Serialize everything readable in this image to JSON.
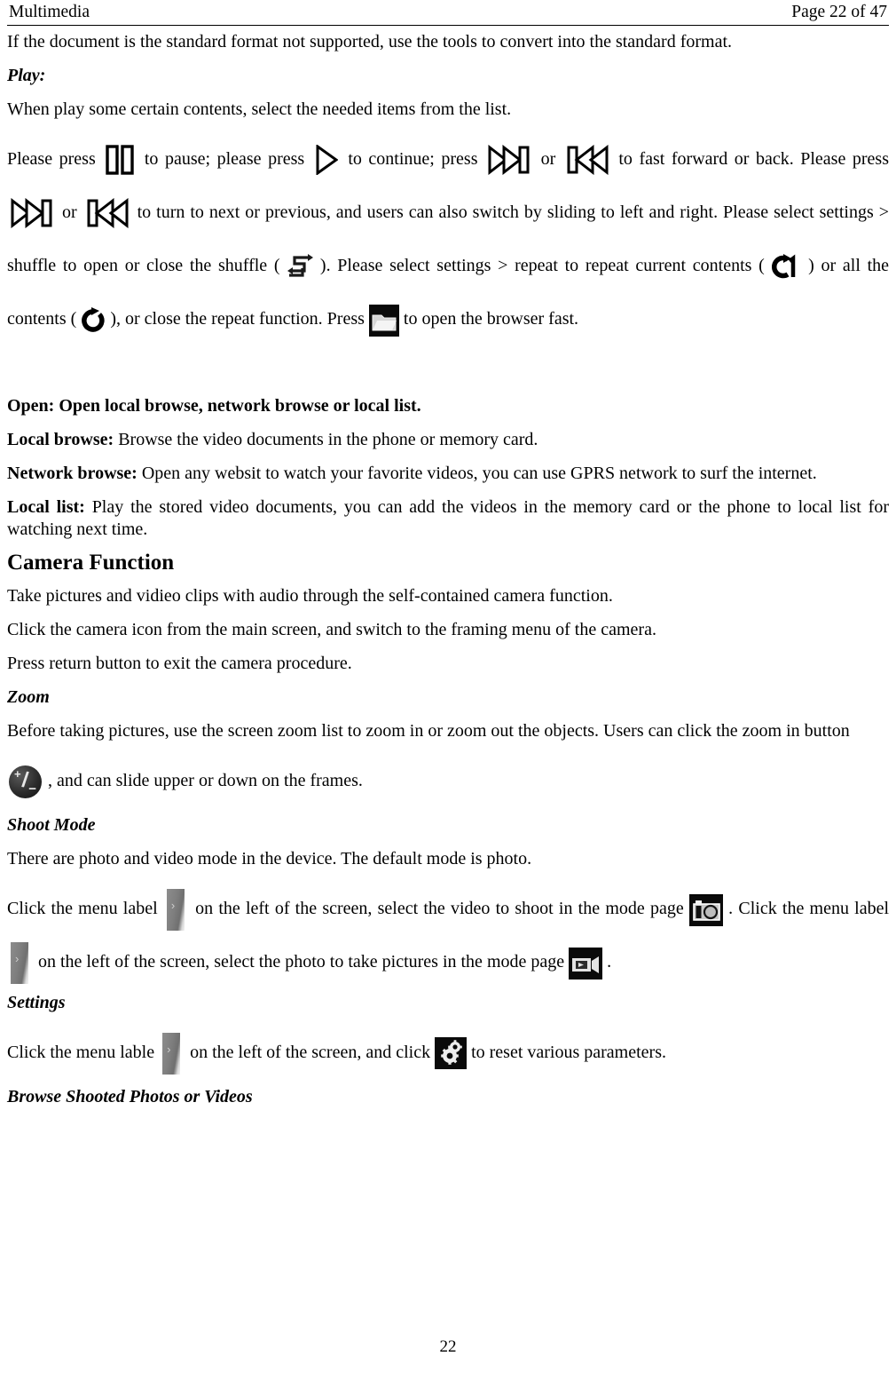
{
  "header": {
    "chapter": "Multimedia",
    "page_indicator": "Page 22 of 47"
  },
  "footer": {
    "page_number": "22"
  },
  "body": {
    "intro": "If the document is the standard format not supported, use the tools to convert into the standard format.",
    "play_heading": "Play:",
    "play_intro": "When play some certain contents, select the needed items from the list.",
    "play_instructions": {
      "s1": "Please press",
      "s2": "to pause; please press",
      "s3": "to continue; press",
      "s4": "or",
      "s5": "to fast forward or back. Please press",
      "s6": "or",
      "s7": "to turn to next or previous, and users can also switch by sliding to left and right. Please select settings > shuffle to open or close the shuffle (",
      "s8": "). Please select settings > repeat to repeat current contents (",
      "s9": ") or all the contents (",
      "s10": "), or close the repeat function. Press",
      "s11": "to open the browser fast."
    },
    "open_heading": "Open: Open local browse, network browse or local list.",
    "local_browse_label": "Local browse:",
    "local_browse_text": "Browse the video documents in the phone or memory card.",
    "network_browse_label": "Network browse:",
    "network_browse_text": "Open any websit to watch your favorite videos, you can use GPRS network to surf the internet.",
    "local_list_label": "Local list:",
    "local_list_text": "Play the stored video documents, you can add the videos in the memory card or the phone to local list for watching next time.",
    "camera_function_heading": "Camera Function",
    "camera_p1": "Take pictures and vidieo clips with audio through the self-contained camera function.",
    "camera_p2": "Click the camera icon from the main screen, and switch to the framing menu of the camera.",
    "camera_p3": "Press return button to exit the camera procedure.",
    "zoom_heading": "Zoom",
    "zoom_p1": "Before taking pictures, use the screen zoom list to zoom in or zoom out the objects. Users can click the zoom in button",
    "zoom_p2": ", and can slide upper or down on the frames.",
    "shoot_mode_heading": "Shoot Mode",
    "shoot_p1": "There are photo and video mode in the device. The default mode is photo.",
    "shoot_p2a": "Click the menu label",
    "shoot_p2b": "on the left of the screen, select the video to shoot in the mode page",
    "shoot_p2c": ". Click the menu label",
    "shoot_p2d": "on the left of the screen, select the photo to take pictures in the mode page",
    "shoot_p2e": ".",
    "settings_heading": "Settings",
    "settings_p1a": "Click the menu lable",
    "settings_p1b": "on the left of the screen, and click",
    "settings_p1c": "to reset various parameters.",
    "browse_heading": "Browse Shooted Photos or Videos"
  },
  "icons": {
    "pause": "pause-icon",
    "play": "play-icon",
    "fast_forward": "fast-forward-icon",
    "rewind": "rewind-icon",
    "shuffle": "shuffle-icon",
    "repeat_one": "repeat-one-icon",
    "repeat_all": "repeat-all-icon",
    "folder_browser": "folder-browser-icon",
    "zoom_button": "zoom-in-out-button-icon",
    "menu_label_tab": "menu-label-chevron-tab-icon",
    "photo_mode": "photo-camera-mode-icon",
    "video_mode": "video-camera-mode-icon",
    "settings_gear": "settings-gear-icon"
  },
  "colors": {
    "text": "#000000",
    "page_background": "#ffffff",
    "rule": "#000000",
    "tile_background": "#000000",
    "tile_glyph": "#f0f0f0",
    "menu_tab_gray": "#7e7e7e"
  }
}
